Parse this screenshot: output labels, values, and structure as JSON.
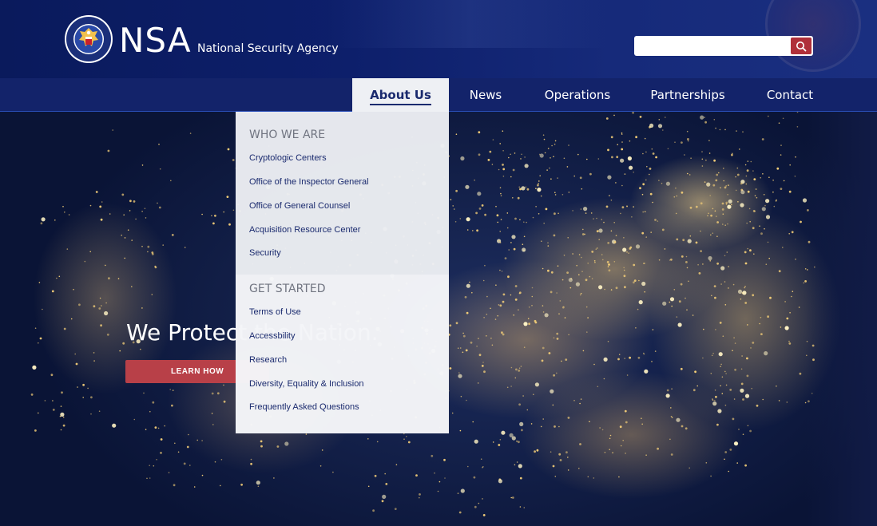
{
  "header": {
    "logo_text": "NSA",
    "logo_subtitle": "National Security Agency",
    "search": {
      "placeholder": ""
    }
  },
  "nav": {
    "items": [
      {
        "label": "About Us",
        "active": true
      },
      {
        "label": "News"
      },
      {
        "label": "Operations"
      },
      {
        "label": "Partnerships"
      },
      {
        "label": "Contact"
      }
    ]
  },
  "dropdown": {
    "section1": {
      "heading": "WHO WE ARE",
      "links": [
        "Cryptologic Centers",
        "Office of the Inspector General",
        "Office of General Counsel",
        "Acquisition Resource Center",
        "Security"
      ]
    },
    "section2": {
      "heading": "GET STARTED",
      "links": [
        "Terms of Use",
        "Accessbility",
        "Research",
        "Diversity, Equality & Inclusion",
        "Frequently Asked Questions"
      ]
    }
  },
  "hero": {
    "title": "We Protect the Nation.",
    "button_label": "LEARN HOW"
  },
  "colors": {
    "header_bg": "#0d1f6b",
    "nav_bg": "#13236a",
    "accent_red": "#b0303a",
    "link_blue": "#1a2a6e"
  },
  "icons": {
    "search": "search-icon",
    "seal": "nsa-seal-icon"
  }
}
